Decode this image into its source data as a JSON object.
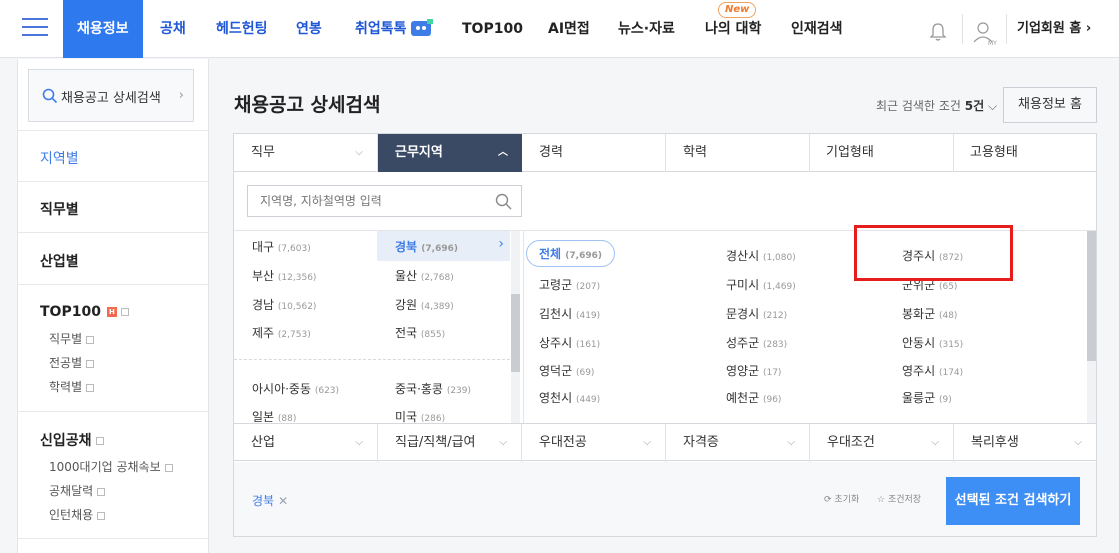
{
  "nav": {
    "items": [
      "채용정보",
      "공채",
      "헤드헌팅",
      "연봉",
      "취업톡톡",
      "TOP100",
      "AI면접",
      "뉴스·자료",
      "나의 대학",
      "인재검색"
    ],
    "new_badge": "New",
    "my_label": "MY",
    "company_link": "기업회원 홈 ›"
  },
  "sidebar": {
    "search_label": "채용공고 상세검색",
    "sections": {
      "region": "지역별",
      "job": "직무별",
      "industry": "산업별",
      "top100": "TOP100",
      "top100_hot": "H",
      "top100_subs": [
        "직무별",
        "전공별",
        "학력별"
      ],
      "gongchae": "신입공채",
      "gongchae_subs": [
        "1000대기업 공채속보",
        "공채달력",
        "인턴채용"
      ]
    }
  },
  "main": {
    "title": "채용공고 상세검색",
    "recent_prefix": "최근 검색한 조건 ",
    "recent_count": "5건",
    "home_button": "채용정보 홈"
  },
  "filters": {
    "tabs": [
      "직무",
      "근무지역",
      "경력",
      "학력",
      "기업형태",
      "고용형태"
    ],
    "selected_tab": "근무지역",
    "row2_tabs": [
      "산업",
      "직급/직책/급여",
      "우대전공",
      "자격증",
      "우대조건",
      "복리후생"
    ],
    "search_placeholder": "지역명, 지하철역명 입력",
    "regions": [
      {
        "name": "대구",
        "count": "(7,603)"
      },
      {
        "name": "경북",
        "count": "(7,696)"
      },
      {
        "name": "부산",
        "count": "(12,356)"
      },
      {
        "name": "울산",
        "count": "(2,768)"
      },
      {
        "name": "경남",
        "count": "(10,562)"
      },
      {
        "name": "강원",
        "count": "(4,389)"
      },
      {
        "name": "제주",
        "count": "(2,753)"
      },
      {
        "name": "전국",
        "count": "(855)"
      },
      {
        "name": "아시아·중동",
        "count": "(623)"
      },
      {
        "name": "중국·홍콩",
        "count": "(239)"
      },
      {
        "name": "일본",
        "count": "(88)"
      },
      {
        "name": "미국",
        "count": "(286)"
      }
    ],
    "cities": [
      {
        "name": "전체",
        "count": "(7,696)"
      },
      {
        "name": "경산시",
        "count": "(1,080)"
      },
      {
        "name": "경주시",
        "count": "(872)"
      },
      {
        "name": "고령군",
        "count": "(207)"
      },
      {
        "name": "구미시",
        "count": "(1,469)"
      },
      {
        "name": "군위군",
        "count": "(65)"
      },
      {
        "name": "김천시",
        "count": "(419)"
      },
      {
        "name": "문경시",
        "count": "(212)"
      },
      {
        "name": "봉화군",
        "count": "(48)"
      },
      {
        "name": "상주시",
        "count": "(161)"
      },
      {
        "name": "성주군",
        "count": "(283)"
      },
      {
        "name": "안동시",
        "count": "(315)"
      },
      {
        "name": "영덕군",
        "count": "(69)"
      },
      {
        "name": "영양군",
        "count": "(17)"
      },
      {
        "name": "영주시",
        "count": "(174)"
      },
      {
        "name": "영천시",
        "count": "(449)"
      },
      {
        "name": "예천군",
        "count": "(96)"
      },
      {
        "name": "울릉군",
        "count": "(9)"
      }
    ],
    "selected_chip": "경북",
    "chip_remove": "✕",
    "reset_label": "초기화",
    "save_label": "조건저장",
    "submit_label": "선택된 조건 검색하기"
  },
  "colors": {
    "brand_blue": "#2f79ef",
    "tab_selected": "#3a4a64",
    "highlight_red": "#e51d1d",
    "submit_blue": "#3d8ef5"
  }
}
